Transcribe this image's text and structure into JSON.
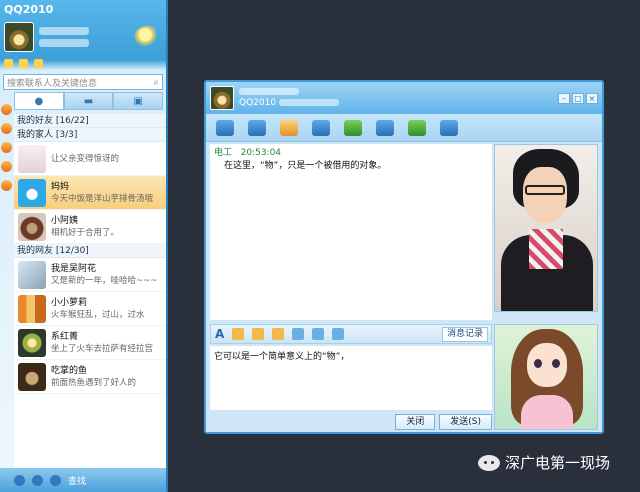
{
  "main": {
    "title": "QQ2010",
    "search_placeholder": "搜索联系人及关键信息",
    "groups": [
      {
        "label": "我的好友 [16/22]"
      },
      {
        "label": "我的家人 [3/3]"
      },
      {
        "label": "我的网友 [12/30]"
      }
    ],
    "contacts": [
      {
        "name": "",
        "sig": "让父亲变得惊讶的"
      },
      {
        "name": "妈妈",
        "sig": "今天中饭是洋山芋排骨汤哦"
      },
      {
        "name": "小阿姨",
        "sig": "相机好于合用了。"
      },
      {
        "name": "我是吴阿花",
        "sig": "又是新的一年，哇哈哈~~~"
      },
      {
        "name": "小小萝莉",
        "sig": "火车猴狂乱，过山，过水"
      },
      {
        "name": "系红菁",
        "sig": "坐上了火车去拉萨有经拉宫"
      },
      {
        "name": "吃掌的鱼",
        "sig": "前面热鱼遇到了好人的"
      }
    ],
    "bottom_label": "查找"
  },
  "chat": {
    "title_status": "QQ2010",
    "message": {
      "sender": "电工",
      "time": "20:53:04",
      "text": "在这里，“物”，只是一个被借用的对象。"
    },
    "input_text": "它可以是一个简单意义上的“物”，",
    "history_label": "消息记录",
    "close_label": "关闭",
    "send_label": "发送(S)"
  },
  "watermark": "深广电第一现场"
}
